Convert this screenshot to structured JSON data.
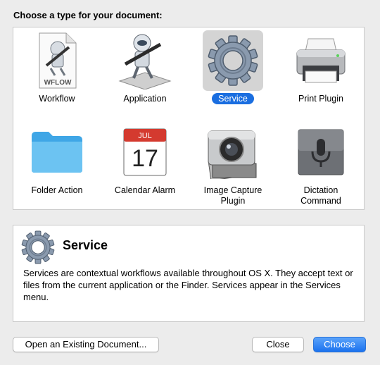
{
  "heading": "Choose a type for your document:",
  "types": [
    {
      "label": "Workflow",
      "icon": "workflow-file-icon",
      "badge": "WFLOW"
    },
    {
      "label": "Application",
      "icon": "automator-robot-icon"
    },
    {
      "label": "Service",
      "icon": "gear-icon",
      "selected": true
    },
    {
      "label": "Print Plugin",
      "icon": "printer-icon"
    },
    {
      "label": "Folder Action",
      "icon": "folder-icon"
    },
    {
      "label": "Calendar Alarm",
      "icon": "calendar-icon",
      "month": "JUL",
      "day": "17"
    },
    {
      "label": "Image Capture\nPlugin",
      "icon": "camera-icon"
    },
    {
      "label": "Dictation\nCommand",
      "icon": "microphone-icon"
    }
  ],
  "description": {
    "title": "Service",
    "text": "Services are contextual workflows available throughout OS X. They accept text or files from the current application or the Finder. Services appear in the Services menu."
  },
  "buttons": {
    "open_existing": "Open an Existing Document...",
    "close": "Close",
    "choose": "Choose"
  },
  "colors": {
    "selection": "#1a6ee0",
    "background": "#ececec"
  }
}
